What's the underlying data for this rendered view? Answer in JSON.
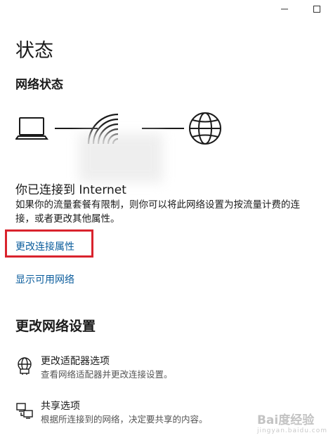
{
  "window": {
    "minimize_icon": "minimize-icon",
    "maximize_icon": "maximize-icon"
  },
  "page": {
    "title": "状态"
  },
  "network_status": {
    "heading": "网络状态",
    "connected_heading": "你已连接到 Internet",
    "description": "如果你的流量套餐有限制，则你可以将此网络设置为按流量计费的连接，或者更改其他属性。"
  },
  "links": {
    "change_properties": "更改连接属性",
    "show_networks": "显示可用网络"
  },
  "change_settings": {
    "heading": "更改网络设置",
    "items": [
      {
        "title": "更改适配器选项",
        "description": "查看网络适配器并更改连接设置。",
        "icon": "adapter-icon"
      },
      {
        "title": "共享选项",
        "description": "根据所连接到的网络，决定要共享的内容。",
        "icon": "sharing-icon"
      }
    ]
  },
  "watermark": {
    "brand": "Bai度经验",
    "url": "jingyan.baidu.com"
  },
  "colors": {
    "link": "#0a5c9c",
    "highlight": "#d9232d"
  }
}
